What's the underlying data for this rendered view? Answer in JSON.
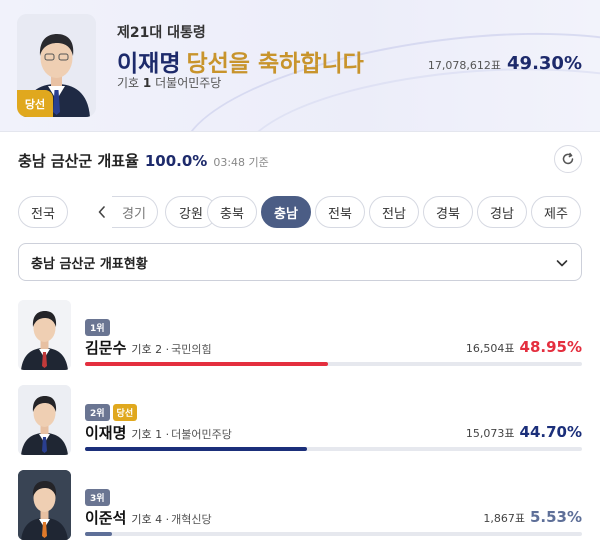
{
  "banner": {
    "election_name": "제21대 대통령",
    "winner_name": "이재명",
    "congrats": "당선을 축하합니다",
    "number_label": "기호",
    "number": "1",
    "party": "더불어민주당",
    "votes": "17,078,612표",
    "percent": "49.30%",
    "badge": "당선"
  },
  "count": {
    "region": "충남 금산군 개표율",
    "rate": "100.0%",
    "time": "03:48 기준"
  },
  "tabs": [
    {
      "label": "전국",
      "active": false
    },
    {
      "label": "경기",
      "active": false
    },
    {
      "label": "강원",
      "active": false
    },
    {
      "label": "충북",
      "active": false
    },
    {
      "label": "충남",
      "active": true
    },
    {
      "label": "전북",
      "active": false
    },
    {
      "label": "전남",
      "active": false
    },
    {
      "label": "경북",
      "active": false
    },
    {
      "label": "경남",
      "active": false
    },
    {
      "label": "제주",
      "active": false
    }
  ],
  "select": {
    "value": "충남 금산군 개표현황"
  },
  "candidates": [
    {
      "rank": "1위",
      "win_badge": "",
      "name": "김문수",
      "number_text": "기호 2",
      "party": "국민의힘",
      "votes": "16,504표",
      "percent": "48.95%",
      "share": 48.95,
      "color": "#e42e3e",
      "photo_bg": "#f2f3f6",
      "tie": "#c23a3a"
    },
    {
      "rank": "2위",
      "win_badge": "당선",
      "name": "이재명",
      "number_text": "기호 1",
      "party": "더불어민주당",
      "votes": "15,073표",
      "percent": "44.70%",
      "share": 44.7,
      "color": "#1b2f7a",
      "photo_bg": "#eceef3",
      "tie": "#2a3f8f"
    },
    {
      "rank": "3위",
      "win_badge": "",
      "name": "이준석",
      "number_text": "기호 4",
      "party": "개혁신당",
      "votes": "1,867표",
      "percent": "5.53%",
      "share": 5.53,
      "color": "#5e6f98",
      "photo_bg": "#394454",
      "tie": "#e07a2a"
    }
  ],
  "colors": {
    "primary": "#1d2a6b",
    "gold": "#c8942c",
    "tab_active": "#4b5d85"
  }
}
